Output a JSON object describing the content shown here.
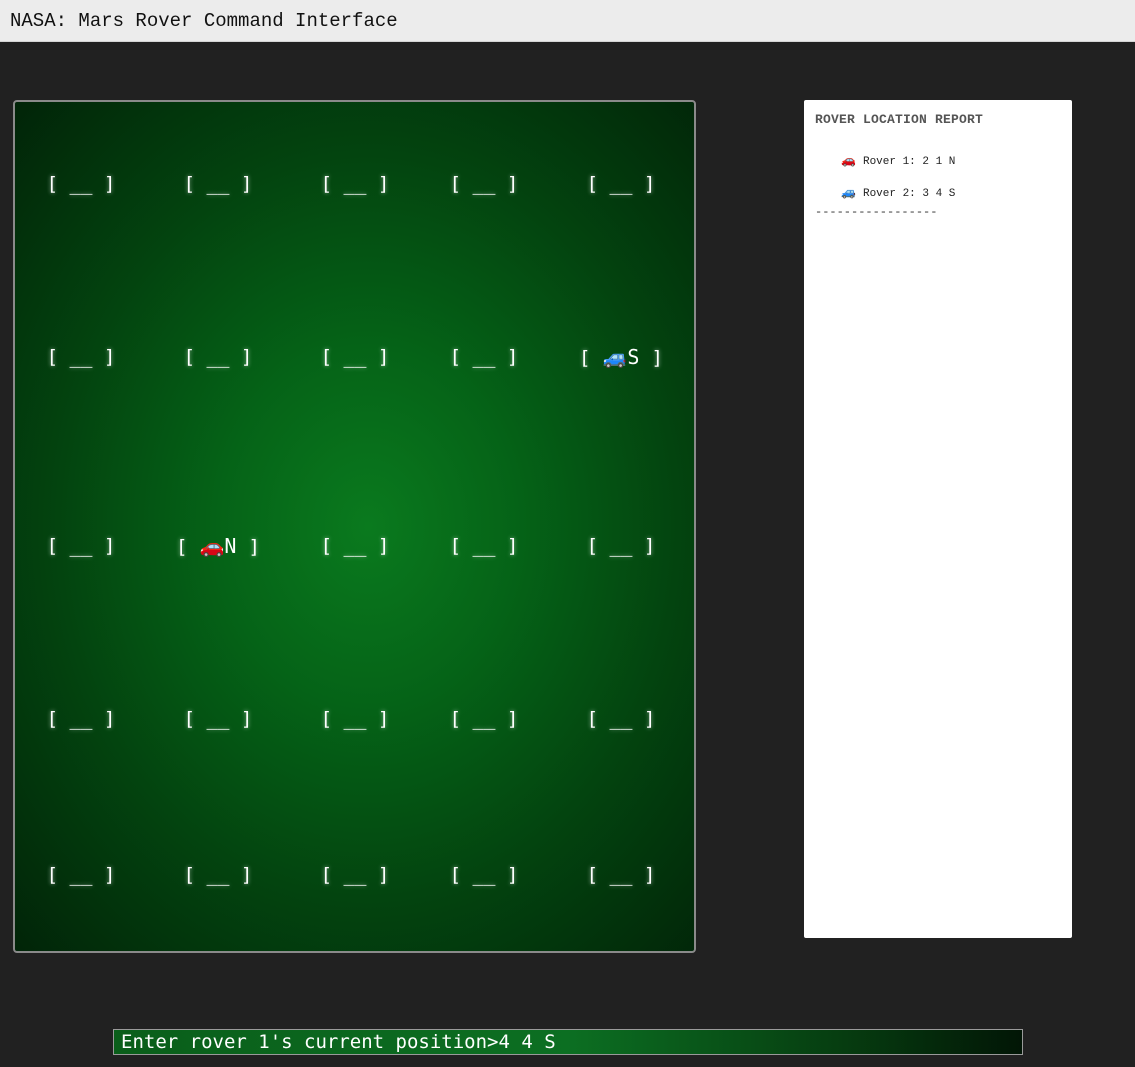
{
  "window": {
    "title": "NASA: Mars Rover Command Interface"
  },
  "grid": {
    "rows": [
      [
        {
          "open": "[",
          "content": " __ ",
          "close": "]"
        },
        {
          "open": "[",
          "content": " __ ",
          "close": "]"
        },
        {
          "open": "[",
          "content": " __ ",
          "close": "]"
        },
        {
          "open": "[",
          "content": " __ ",
          "close": "]"
        },
        {
          "open": "[",
          "content": " __ ",
          "close": "]"
        }
      ],
      [
        {
          "open": "[",
          "content": " __ ",
          "close": "]"
        },
        {
          "open": "[",
          "content": " __ ",
          "close": "]"
        },
        {
          "open": "[",
          "content": " __ ",
          "close": "]"
        },
        {
          "open": "[",
          "content": " __ ",
          "close": "]"
        },
        {
          "open": "[",
          "content": " 🚙S ",
          "close": "]",
          "rover": "rover-2",
          "icon": "blue-car-icon"
        }
      ],
      [
        {
          "open": "[",
          "content": " __ ",
          "close": "]"
        },
        {
          "open": "[",
          "content": " 🚗N ",
          "close": "]",
          "rover": "rover-1",
          "icon": "red-car-icon"
        },
        {
          "open": "[",
          "content": " __ ",
          "close": "]"
        },
        {
          "open": "[",
          "content": " __ ",
          "close": "]"
        },
        {
          "open": "[",
          "content": " __ ",
          "close": "]"
        }
      ],
      [
        {
          "open": "[",
          "content": " __ ",
          "close": "]"
        },
        {
          "open": "[",
          "content": " __ ",
          "close": "]"
        },
        {
          "open": "[",
          "content": " __ ",
          "close": "]"
        },
        {
          "open": "[",
          "content": " __ ",
          "close": "]"
        },
        {
          "open": "[",
          "content": " __ ",
          "close": "]"
        }
      ],
      [
        {
          "open": "[",
          "content": " __ ",
          "close": "]"
        },
        {
          "open": "[",
          "content": " __ ",
          "close": "]"
        },
        {
          "open": "[",
          "content": " __ ",
          "close": "]"
        },
        {
          "open": "[",
          "content": " __ ",
          "close": "]"
        },
        {
          "open": "[",
          "content": " __ ",
          "close": "]"
        }
      ]
    ]
  },
  "report": {
    "title": "ROVER LOCATION REPORT",
    "rovers": [
      {
        "icon": "🚗",
        "icon_name": "red-car-icon",
        "text": "Rover 1: 2 1 N"
      },
      {
        "icon": "🚙",
        "icon_name": "blue-car-icon",
        "text": "Rover 2: 3 4 S"
      }
    ],
    "separator": "-----------------"
  },
  "command": {
    "prompt": "Enter rover 1's current position>",
    "value": "4 4 S"
  },
  "colors": {
    "background": "#212121",
    "grid_green": "#0a7a1e",
    "title_bar": "#ececec"
  }
}
